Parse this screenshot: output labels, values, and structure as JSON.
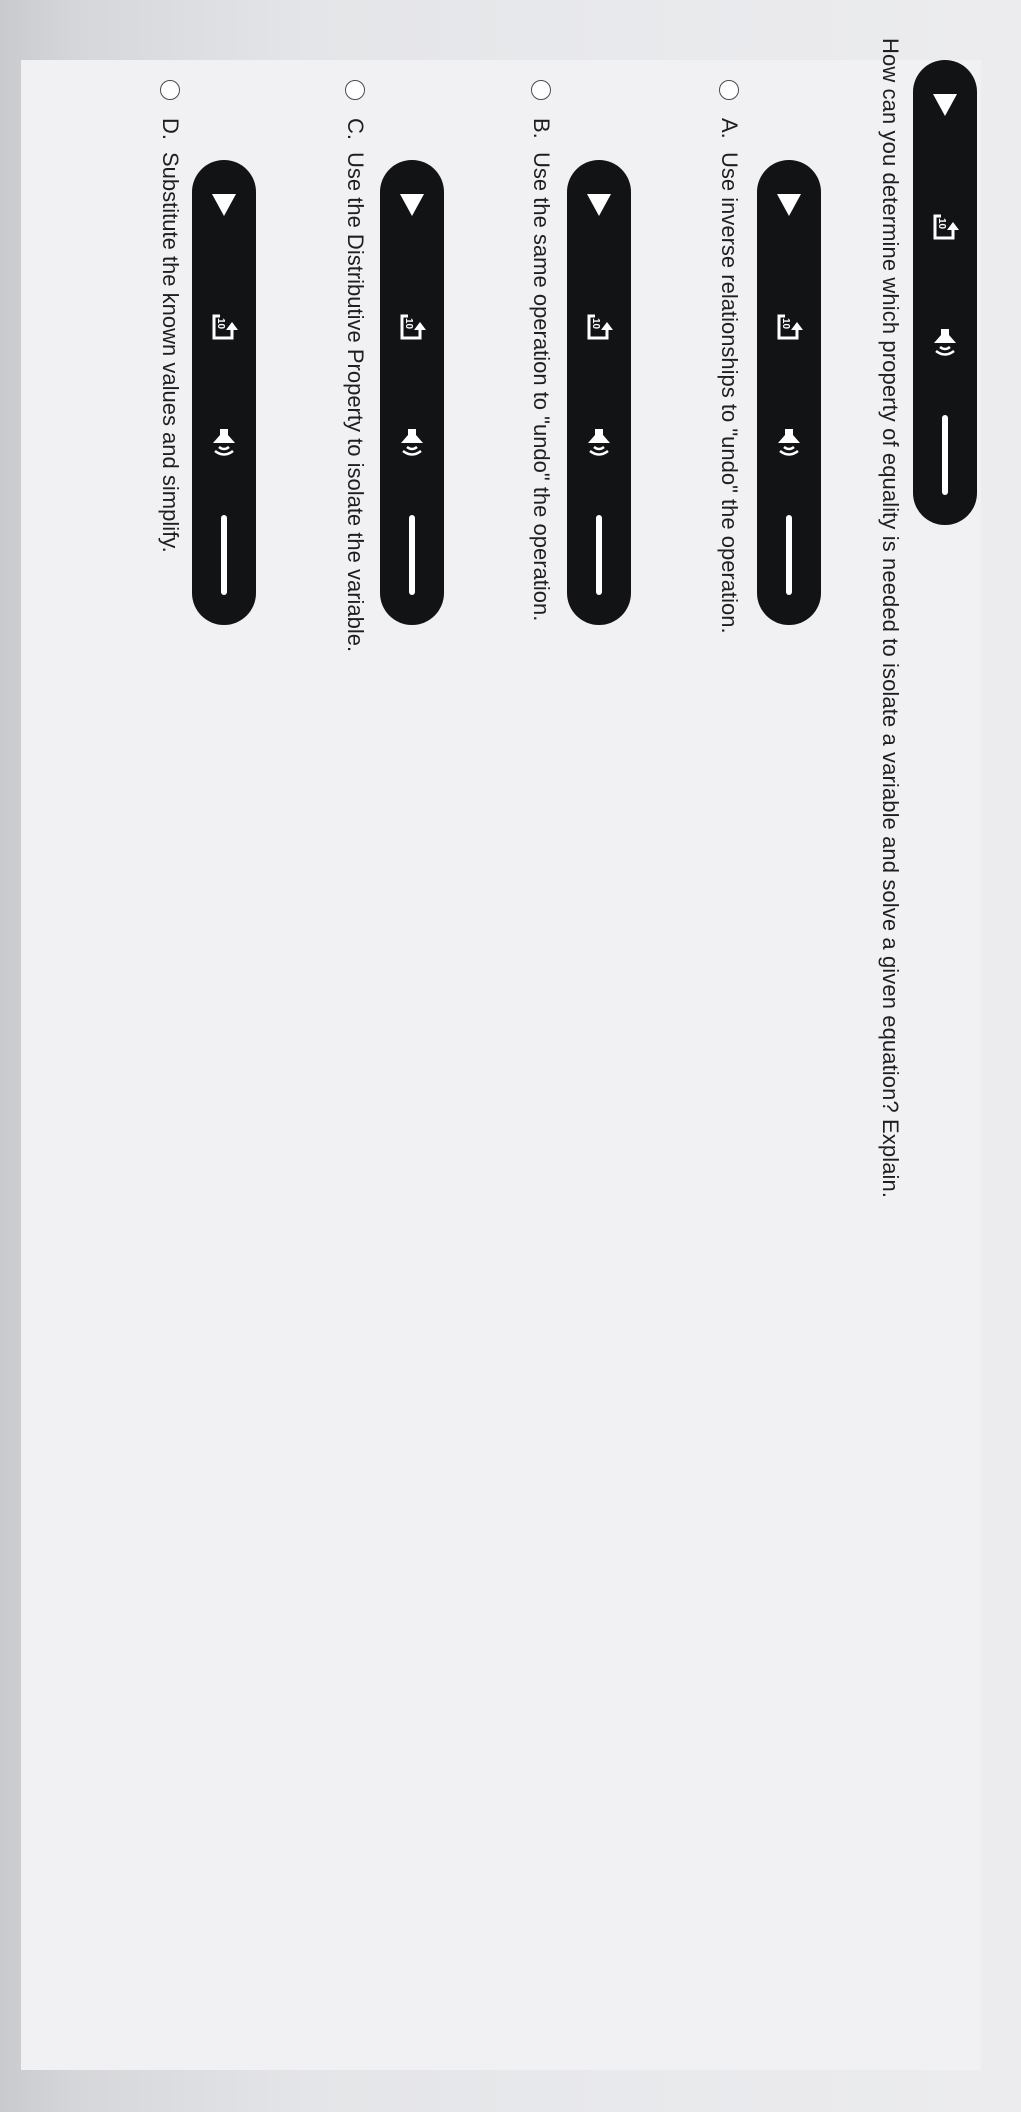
{
  "question": {
    "text": "How can you determine which property of equality is needed to isolate a variable and solve a given equation? Explain."
  },
  "audio_player": {
    "rewind_label": "10"
  },
  "options": [
    {
      "letter": "A.",
      "text": "Use inverse relationships to \"undo\" the operation."
    },
    {
      "letter": "B.",
      "text": "Use the same operation to \"undo\" the operation."
    },
    {
      "letter": "C.",
      "text": "Use the Distributive Property to isolate the variable."
    },
    {
      "letter": "D.",
      "text": "Substitute the known values and simplify."
    }
  ],
  "colors": {
    "player_background": "#111315",
    "page_background": "#f1f1f3",
    "text": "#1f1f22"
  }
}
